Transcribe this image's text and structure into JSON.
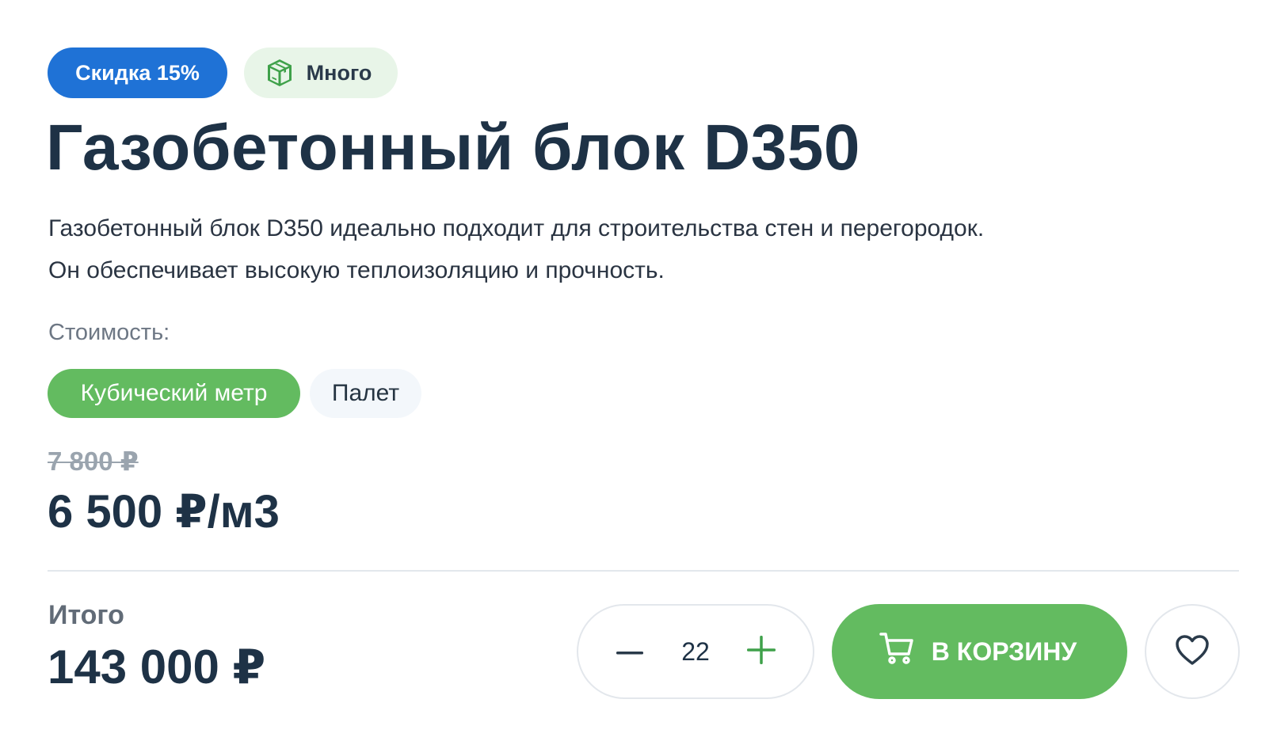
{
  "badges": {
    "discount": "Скидка 15%",
    "stock": "Много",
    "stock_icon": "package-box-icon"
  },
  "product": {
    "title": "Газобетонный блок D350",
    "description_line1": "Газобетонный блок D350 идеально подходит для строительства стен и перегородок.",
    "description_line2": "Он обеспечивает высокую теплоизоляцию и прочность."
  },
  "pricing": {
    "label": "Стоимость:",
    "units": [
      {
        "label": "Кубический метр",
        "selected": true
      },
      {
        "label": "Палет",
        "selected": false
      }
    ],
    "old_price": "7 800 ₽",
    "current_price": "6 500 ₽/м3"
  },
  "total": {
    "label": "Итого",
    "value": "143 000 ₽"
  },
  "quantity": {
    "value": "22",
    "minus_icon": "minus-icon",
    "plus_icon": "plus-icon"
  },
  "actions": {
    "cart_label": "В КОРЗИНУ",
    "cart_icon": "shopping-cart-icon",
    "favorite_icon": "heart-icon"
  },
  "colors": {
    "primary_blue": "#1f72d6",
    "accent_green": "#63bb60",
    "text_dark": "#1e3246",
    "stock_badge_bg": "#e8f5e8"
  }
}
